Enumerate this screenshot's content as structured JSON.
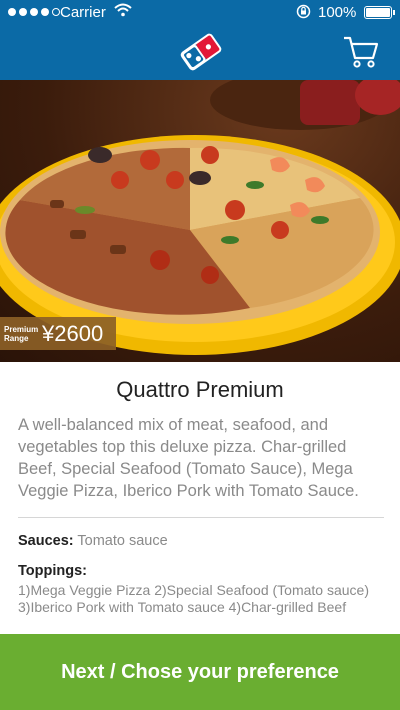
{
  "status_bar": {
    "carrier": "Carrier",
    "battery_percent": "100%",
    "signal_bars": 4,
    "signal_total": 5,
    "battery_level": 1.0
  },
  "nav": {
    "logo_icon": "dominos-logo-icon",
    "cart_icon": "cart-icon",
    "bar_color": "#0b6aa6"
  },
  "product": {
    "image_icon": "pizza-photo",
    "price_range_label": "Premium Range",
    "price": "¥2600",
    "title": "Quattro Premium",
    "description": "A well-balanced mix of meat, seafood, and vegetables top this deluxe pizza. Char-grilled Beef, Special Seafood (Tomato Sauce), Mega Veggie Pizza, Iberico Pork with Tomato Sauce.",
    "sauces_label": "Sauces:",
    "sauces_value": "Tomato sauce",
    "toppings_label": "Toppings:",
    "toppings_value": "1)Mega Veggie Pizza 2)Special Seafood (Tomato sauce) 3)Iberico Pork with Tomato sauce 4)Char-grilled Beef"
  },
  "footer": {
    "next_label": "Next / Chose your preference",
    "button_color": "#6aae31"
  }
}
